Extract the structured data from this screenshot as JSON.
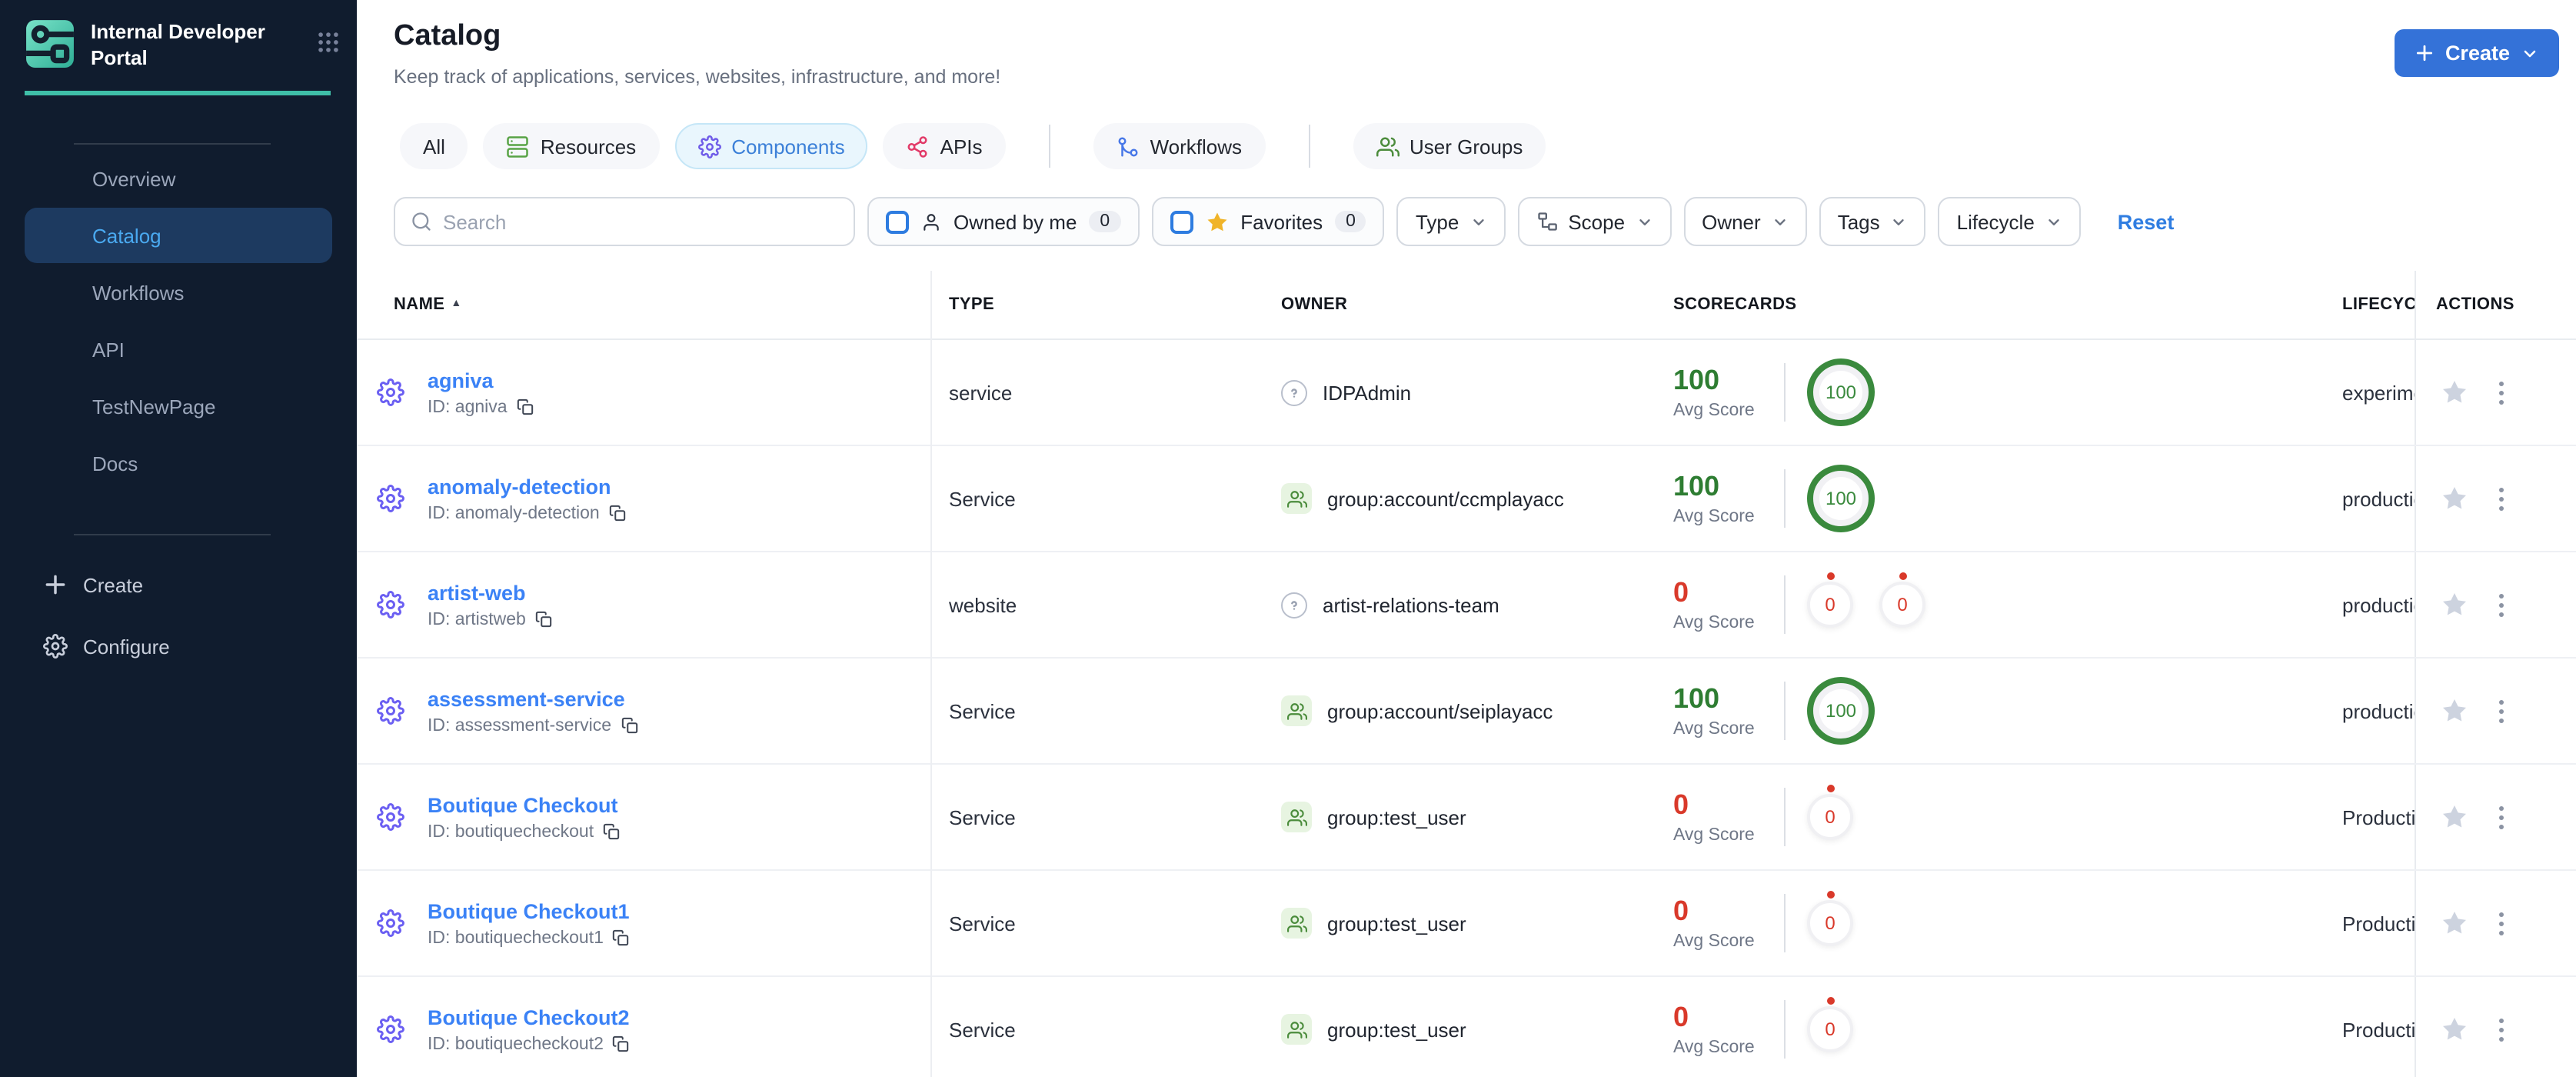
{
  "brand": {
    "title": "Internal Developer Portal"
  },
  "sidebar": {
    "items": [
      {
        "label": "Overview",
        "active": false
      },
      {
        "label": "Catalog",
        "active": true
      },
      {
        "label": "Workflows",
        "active": false
      },
      {
        "label": "API",
        "active": false
      },
      {
        "label": "TestNewPage",
        "active": false
      },
      {
        "label": "Docs",
        "active": false
      }
    ],
    "create_label": "Create",
    "configure_label": "Configure"
  },
  "header": {
    "title": "Catalog",
    "subtitle": "Keep track of applications, services, websites, infrastructure, and more!",
    "create_button": "Create"
  },
  "tabs": [
    {
      "label": "All",
      "icon": "none",
      "active": false
    },
    {
      "label": "Resources",
      "icon": "server-icon",
      "active": false
    },
    {
      "label": "Components",
      "icon": "gear-icon",
      "active": true
    },
    {
      "label": "APIs",
      "icon": "api-icon",
      "active": false
    },
    {
      "label": "Workflows",
      "icon": "workflow-icon",
      "active": false
    },
    {
      "label": "User Groups",
      "icon": "users-icon",
      "active": false
    }
  ],
  "filters": {
    "search_placeholder": "Search",
    "owned_by_me": {
      "label": "Owned by me",
      "count": "0"
    },
    "favorites": {
      "label": "Favorites",
      "count": "0"
    },
    "dropdowns": [
      {
        "label": "Type",
        "icon": "none"
      },
      {
        "label": "Scope",
        "icon": "hierarchy-icon"
      },
      {
        "label": "Owner",
        "icon": "none"
      },
      {
        "label": "Tags",
        "icon": "none"
      },
      {
        "label": "Lifecycle",
        "icon": "none"
      }
    ],
    "reset_label": "Reset"
  },
  "table": {
    "columns": {
      "name": "NAME",
      "type": "TYPE",
      "owner": "OWNER",
      "scorecards": "SCORECARDS",
      "lifecycle": "LIFECYCLE",
      "actions": "ACTIONS"
    },
    "avg_score_label": "Avg Score",
    "rows": [
      {
        "name": "agniva",
        "id": "ID: agniva",
        "type": "service",
        "owner": {
          "kind": "unknown",
          "label": "IDPAdmin"
        },
        "avg_score": "100",
        "score_state": "good",
        "rings": [
          {
            "value": "100",
            "state": "good"
          }
        ],
        "lifecycle": "experimental"
      },
      {
        "name": "anomaly-detection",
        "id": "ID: anomaly-detection",
        "type": "Service",
        "owner": {
          "kind": "group",
          "label": "group:account/ccmplayacc"
        },
        "avg_score": "100",
        "score_state": "good",
        "rings": [
          {
            "value": "100",
            "state": "good"
          }
        ],
        "lifecycle": "production"
      },
      {
        "name": "artist-web",
        "id": "ID: artistweb",
        "type": "website",
        "owner": {
          "kind": "unknown",
          "label": "artist-relations-team"
        },
        "avg_score": "0",
        "score_state": "bad",
        "rings": [
          {
            "value": "0",
            "state": "bad"
          },
          {
            "value": "0",
            "state": "bad"
          }
        ],
        "lifecycle": "production"
      },
      {
        "name": "assessment-service",
        "id": "ID: assessment-service",
        "type": "Service",
        "owner": {
          "kind": "group",
          "label": "group:account/seiplayacc"
        },
        "avg_score": "100",
        "score_state": "good",
        "rings": [
          {
            "value": "100",
            "state": "good"
          }
        ],
        "lifecycle": "production"
      },
      {
        "name": "Boutique Checkout",
        "id": "ID: boutiquecheckout",
        "type": "Service",
        "owner": {
          "kind": "group",
          "label": "group:test_user"
        },
        "avg_score": "0",
        "score_state": "bad",
        "rings": [
          {
            "value": "0",
            "state": "bad"
          }
        ],
        "lifecycle": "Production"
      },
      {
        "name": "Boutique Checkout1",
        "id": "ID: boutiquecheckout1",
        "type": "Service",
        "owner": {
          "kind": "group",
          "label": "group:test_user"
        },
        "avg_score": "0",
        "score_state": "bad",
        "rings": [
          {
            "value": "0",
            "state": "bad"
          }
        ],
        "lifecycle": "Production"
      },
      {
        "name": "Boutique Checkout2",
        "id": "ID: boutiquecheckout2",
        "type": "Service",
        "owner": {
          "kind": "group",
          "label": "group:test_user"
        },
        "avg_score": "0",
        "score_state": "bad",
        "rings": [
          {
            "value": "0",
            "state": "bad"
          }
        ],
        "lifecycle": "Production"
      }
    ]
  },
  "colors": {
    "sidebar_bg": "#101c2e",
    "accent_teal": "#3fbfa8",
    "primary_blue": "#3472d8",
    "link_blue": "#3b82f6",
    "good_green": "#2e7d32",
    "bad_red": "#d9392a",
    "active_item_bg": "#1d3a60",
    "active_item_text": "#4aa9f0"
  }
}
